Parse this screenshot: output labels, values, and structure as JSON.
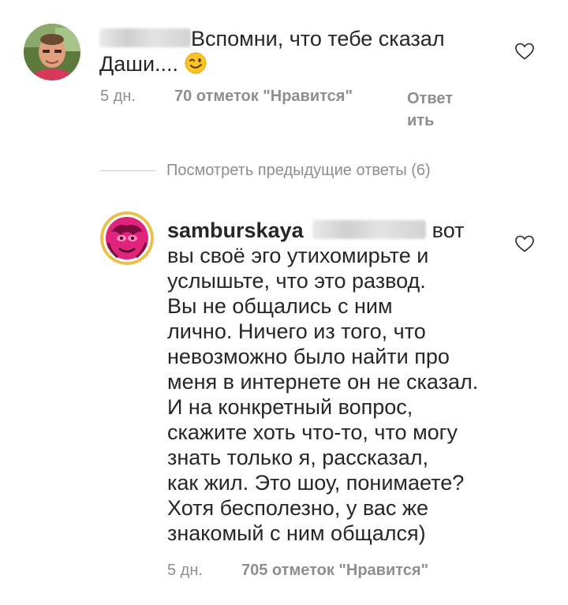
{
  "comment1": {
    "text_line1": "Вспомни, что тебе сказал",
    "text_line2": "Даши....",
    "time": "5 дн.",
    "likes": "70 отметок \"Нравится\"",
    "reply_line1": "Ответ",
    "reply_line2": "ить"
  },
  "replies": {
    "view_previous": "Посмотреть предыдущие ответы (6)"
  },
  "comment2": {
    "username": "samburskaya",
    "first_word": "вот",
    "lines": [
      "вы своё эго утихомирьте и",
      "услышьте, что это развод.",
      "Вы не общались с ним",
      "лично. Ничего из того, что",
      "невозможно было найти про",
      "меня в интернете он не сказал.",
      "И на конкретный вопрос,",
      "скажите хоть что-то, что могу",
      "знать только я, рассказал,",
      "как жил. Это шоу, понимаете?",
      "Хотя бесполезно, у вас же",
      "знакомый с ним общался)"
    ],
    "time": "5 дн.",
    "likes": "705 отметок \"Нравится\""
  },
  "icons": {
    "heart": "heart-outline-icon",
    "emoji": "winking-face-emoji"
  }
}
